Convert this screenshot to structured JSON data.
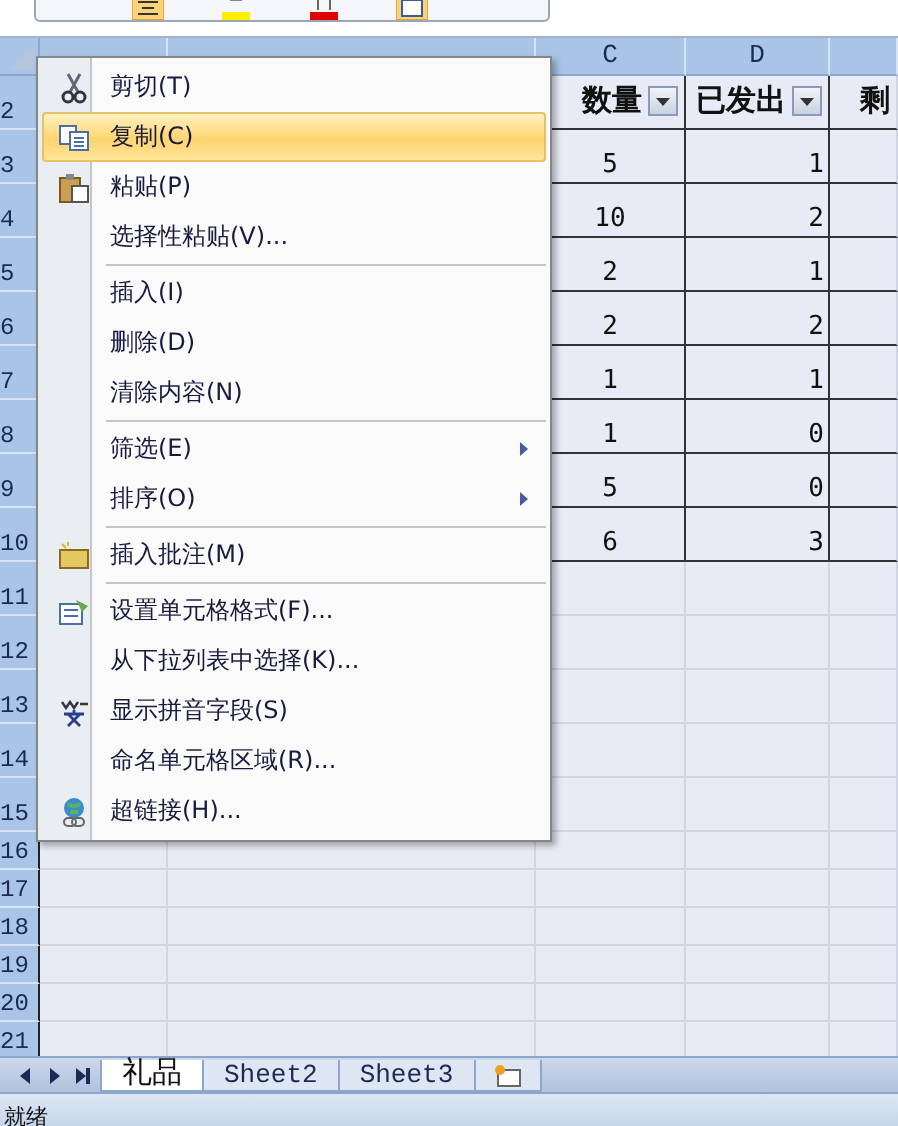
{
  "column_headers": [
    "C",
    "D"
  ],
  "rows": [
    {
      "number": "2",
      "kind": "header",
      "cells": [
        {
          "text": "数量",
          "filter": true
        },
        {
          "text": "已发出",
          "filter": true
        },
        {
          "text": "剩"
        }
      ]
    },
    {
      "number": "3",
      "kind": "data",
      "cells": [
        "5",
        "1"
      ]
    },
    {
      "number": "4",
      "kind": "data",
      "cells": [
        "10",
        "2"
      ]
    },
    {
      "number": "5",
      "kind": "data",
      "cells": [
        "2",
        "1"
      ]
    },
    {
      "number": "6",
      "kind": "data",
      "cells": [
        "2",
        "2"
      ]
    },
    {
      "number": "7",
      "kind": "data",
      "cells": [
        "1",
        "1"
      ]
    },
    {
      "number": "8",
      "kind": "data",
      "cells": [
        "1",
        "0"
      ]
    },
    {
      "number": "9",
      "kind": "data",
      "cells": [
        "5",
        "0"
      ]
    },
    {
      "number": "10",
      "kind": "data",
      "cells": [
        "6",
        "3"
      ]
    },
    {
      "number": "11",
      "kind": "empty"
    },
    {
      "number": "12",
      "kind": "empty"
    },
    {
      "number": "13",
      "kind": "empty"
    },
    {
      "number": "14",
      "kind": "empty"
    },
    {
      "number": "15",
      "kind": "empty"
    },
    {
      "number": "16",
      "kind": "short"
    },
    {
      "number": "17",
      "kind": "short"
    },
    {
      "number": "18",
      "kind": "short"
    },
    {
      "number": "19",
      "kind": "short"
    },
    {
      "number": "20",
      "kind": "short"
    },
    {
      "number": "21",
      "kind": "short"
    }
  ],
  "context_menu": [
    {
      "kind": "item",
      "label": "剪切(T)",
      "selected": false,
      "submenu": false
    },
    {
      "kind": "item",
      "label": "复制(C)",
      "selected": true,
      "submenu": false
    },
    {
      "kind": "item",
      "label": "粘贴(P)",
      "selected": false,
      "submenu": false
    },
    {
      "kind": "item",
      "label": "选择性粘贴(V)...",
      "selected": false,
      "submenu": false
    },
    {
      "kind": "separator"
    },
    {
      "kind": "item",
      "label": "插入(I)",
      "selected": false,
      "submenu": false
    },
    {
      "kind": "item",
      "label": "删除(D)",
      "selected": false,
      "submenu": false
    },
    {
      "kind": "item",
      "label": "清除内容(N)",
      "selected": false,
      "submenu": false
    },
    {
      "kind": "separator"
    },
    {
      "kind": "item",
      "label": "筛选(E)",
      "selected": false,
      "submenu": true
    },
    {
      "kind": "item",
      "label": "排序(O)",
      "selected": false,
      "submenu": true
    },
    {
      "kind": "separator"
    },
    {
      "kind": "item",
      "label": "插入批注(M)",
      "selected": false,
      "submenu": false
    },
    {
      "kind": "separator"
    },
    {
      "kind": "item",
      "label": "设置单元格格式(F)...",
      "selected": false,
      "submenu": false
    },
    {
      "kind": "item",
      "label": "从下拉列表中选择(K)...",
      "selected": false,
      "submenu": false
    },
    {
      "kind": "item",
      "label": "显示拼音字段(S)",
      "selected": false,
      "submenu": false
    },
    {
      "kind": "item",
      "label": "命名单元格区域(R)...",
      "selected": false,
      "submenu": false
    },
    {
      "kind": "item",
      "label": "超链接(H)...",
      "selected": false,
      "submenu": false
    }
  ],
  "sheet_tabs": [
    {
      "label": "礼品",
      "selected": true
    },
    {
      "label": "Sheet2",
      "selected": false
    },
    {
      "label": "Sheet3",
      "selected": false
    }
  ],
  "status_bar": "就绪"
}
